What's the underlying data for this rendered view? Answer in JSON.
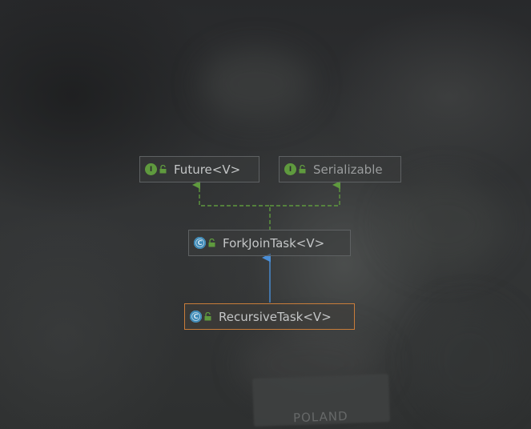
{
  "diagram": {
    "nodes": [
      {
        "id": "future",
        "label": "Future<V>",
        "kind": "interface",
        "kind_glyph": "I",
        "icon": "interface-icon",
        "access": "public-lock-icon"
      },
      {
        "id": "serializable",
        "label": "Serializable",
        "kind": "interface",
        "kind_glyph": "I",
        "icon": "interface-icon",
        "access": "public-lock-icon"
      },
      {
        "id": "forkjointask",
        "label": "ForkJoinTask<V>",
        "kind": "abstract-class",
        "kind_glyph": "C",
        "icon": "abstract-class-icon",
        "access": "public-lock-icon"
      },
      {
        "id": "recursivetask",
        "label": "RecursiveTask<V>",
        "kind": "abstract-class",
        "kind_glyph": "C",
        "icon": "abstract-class-icon",
        "access": "public-lock-icon",
        "selected": true
      }
    ],
    "edges": [
      {
        "from": "forkjointask",
        "to": "future",
        "type": "implements"
      },
      {
        "from": "forkjointask",
        "to": "serializable",
        "type": "implements"
      },
      {
        "from": "recursivetask",
        "to": "forkjointask",
        "type": "extends"
      }
    ],
    "colors": {
      "implements": "#5f9a3e",
      "extends": "#4a8fd8",
      "selected_border": "#c97d3a"
    }
  },
  "background": {
    "patch_text": "POLAND"
  }
}
